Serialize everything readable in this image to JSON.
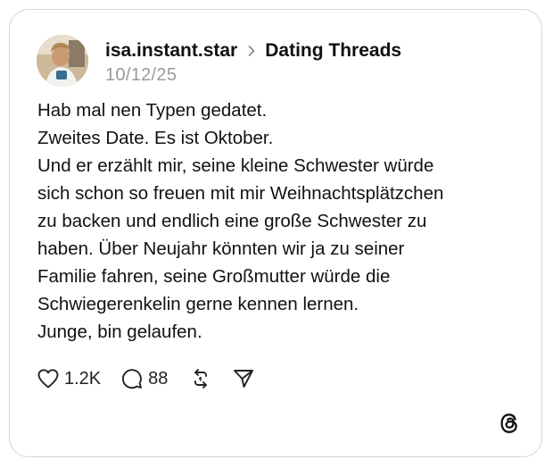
{
  "post": {
    "username": "isa.instant.star",
    "channel": "Dating Threads",
    "date": "10/12/25",
    "lines": [
      "Hab mal nen Typen gedatet.",
      "Zweites Date. Es ist Oktober.",
      "Und er erzählt mir, seine kleine Schwester würde",
      "sich schon so freuen mit mir Weihnachtsplätzchen",
      "zu backen und endlich eine große Schwester zu",
      "haben. Über Neujahr könnten wir ja zu seiner",
      "Familie fahren, seine Großmutter würde die",
      "Schwiegerenkelin gerne kennen lernen.",
      "Junge, bin gelaufen."
    ]
  },
  "actions": {
    "likes": "1.2K",
    "replies": "88"
  },
  "icons": {
    "separator": "chevron-right-icon",
    "like": "heart-icon",
    "reply": "comment-icon",
    "repost": "repost-icon",
    "share": "send-icon",
    "logo": "threads-logo-icon"
  }
}
